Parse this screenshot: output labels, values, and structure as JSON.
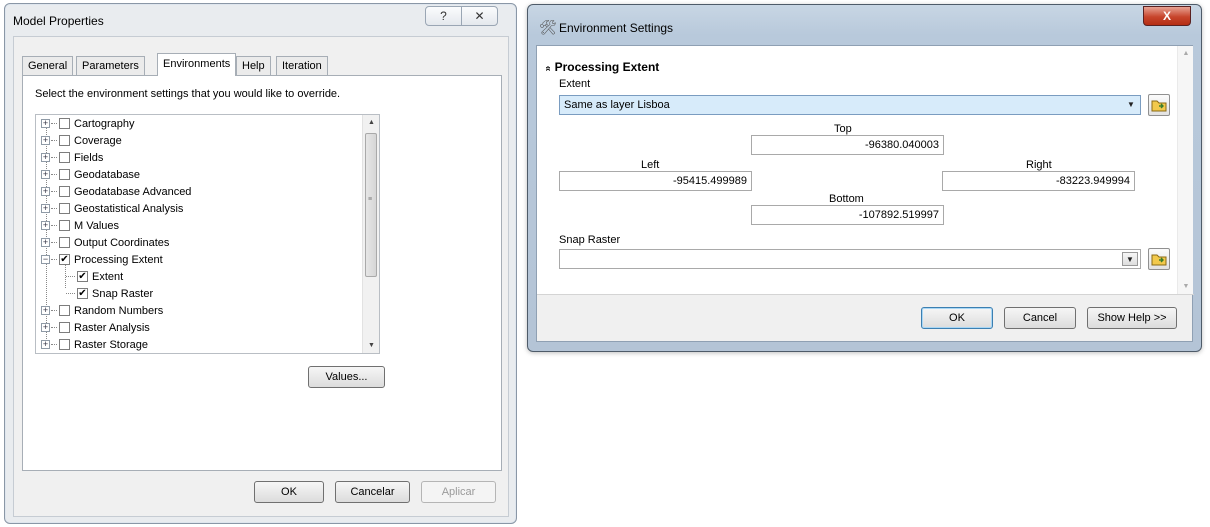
{
  "model_properties": {
    "title": "Model Properties",
    "help_glyph": "?",
    "close_glyph": "✕",
    "tabs": [
      {
        "label": "General",
        "active": false
      },
      {
        "label": "Parameters",
        "active": false
      },
      {
        "label": "Environments",
        "active": true
      },
      {
        "label": "Help",
        "active": false
      },
      {
        "label": "Iteration",
        "active": false
      }
    ],
    "prompt": "Select the environment settings that you would like to override.",
    "tree": [
      {
        "label": "Cartography",
        "expander": "+",
        "checked": false
      },
      {
        "label": "Coverage",
        "expander": "+",
        "checked": false
      },
      {
        "label": "Fields",
        "expander": "+",
        "checked": false
      },
      {
        "label": "Geodatabase",
        "expander": "+",
        "checked": false
      },
      {
        "label": "Geodatabase Advanced",
        "expander": "+",
        "checked": false
      },
      {
        "label": "Geostatistical Analysis",
        "expander": "+",
        "checked": false
      },
      {
        "label": "M Values",
        "expander": "+",
        "checked": false
      },
      {
        "label": "Output Coordinates",
        "expander": "+",
        "checked": false
      },
      {
        "label": "Processing Extent",
        "expander": "−",
        "checked": true
      },
      {
        "label": "Extent",
        "child": true,
        "checked": true
      },
      {
        "label": "Snap Raster",
        "child": true,
        "checked": true
      },
      {
        "label": "Random Numbers",
        "expander": "+",
        "checked": false
      },
      {
        "label": "Raster Analysis",
        "expander": "+",
        "checked": false
      },
      {
        "label": "Raster Storage",
        "expander": "+",
        "checked": false
      }
    ],
    "values_button": "Values...",
    "ok_button": "OK",
    "cancel_button": "Cancelar",
    "apply_button": "Aplicar"
  },
  "environment_settings": {
    "title": "Environment Settings",
    "close_glyph": "X",
    "section_title": "Processing Extent",
    "section_chevron": "«",
    "extent_label": "Extent",
    "extent_value": "Same as layer Lisboa",
    "top_label": "Top",
    "top_value": "-96380.040003",
    "left_label": "Left",
    "left_value": "-95415.499989",
    "right_label": "Right",
    "right_value": "-83223.949994",
    "bottom_label": "Bottom",
    "bottom_value": "-107892.519997",
    "snap_raster_label": "Snap Raster",
    "snap_raster_value": "",
    "ok_button": "OK",
    "cancel_button": "Cancel",
    "show_help_button": "Show Help >>"
  }
}
